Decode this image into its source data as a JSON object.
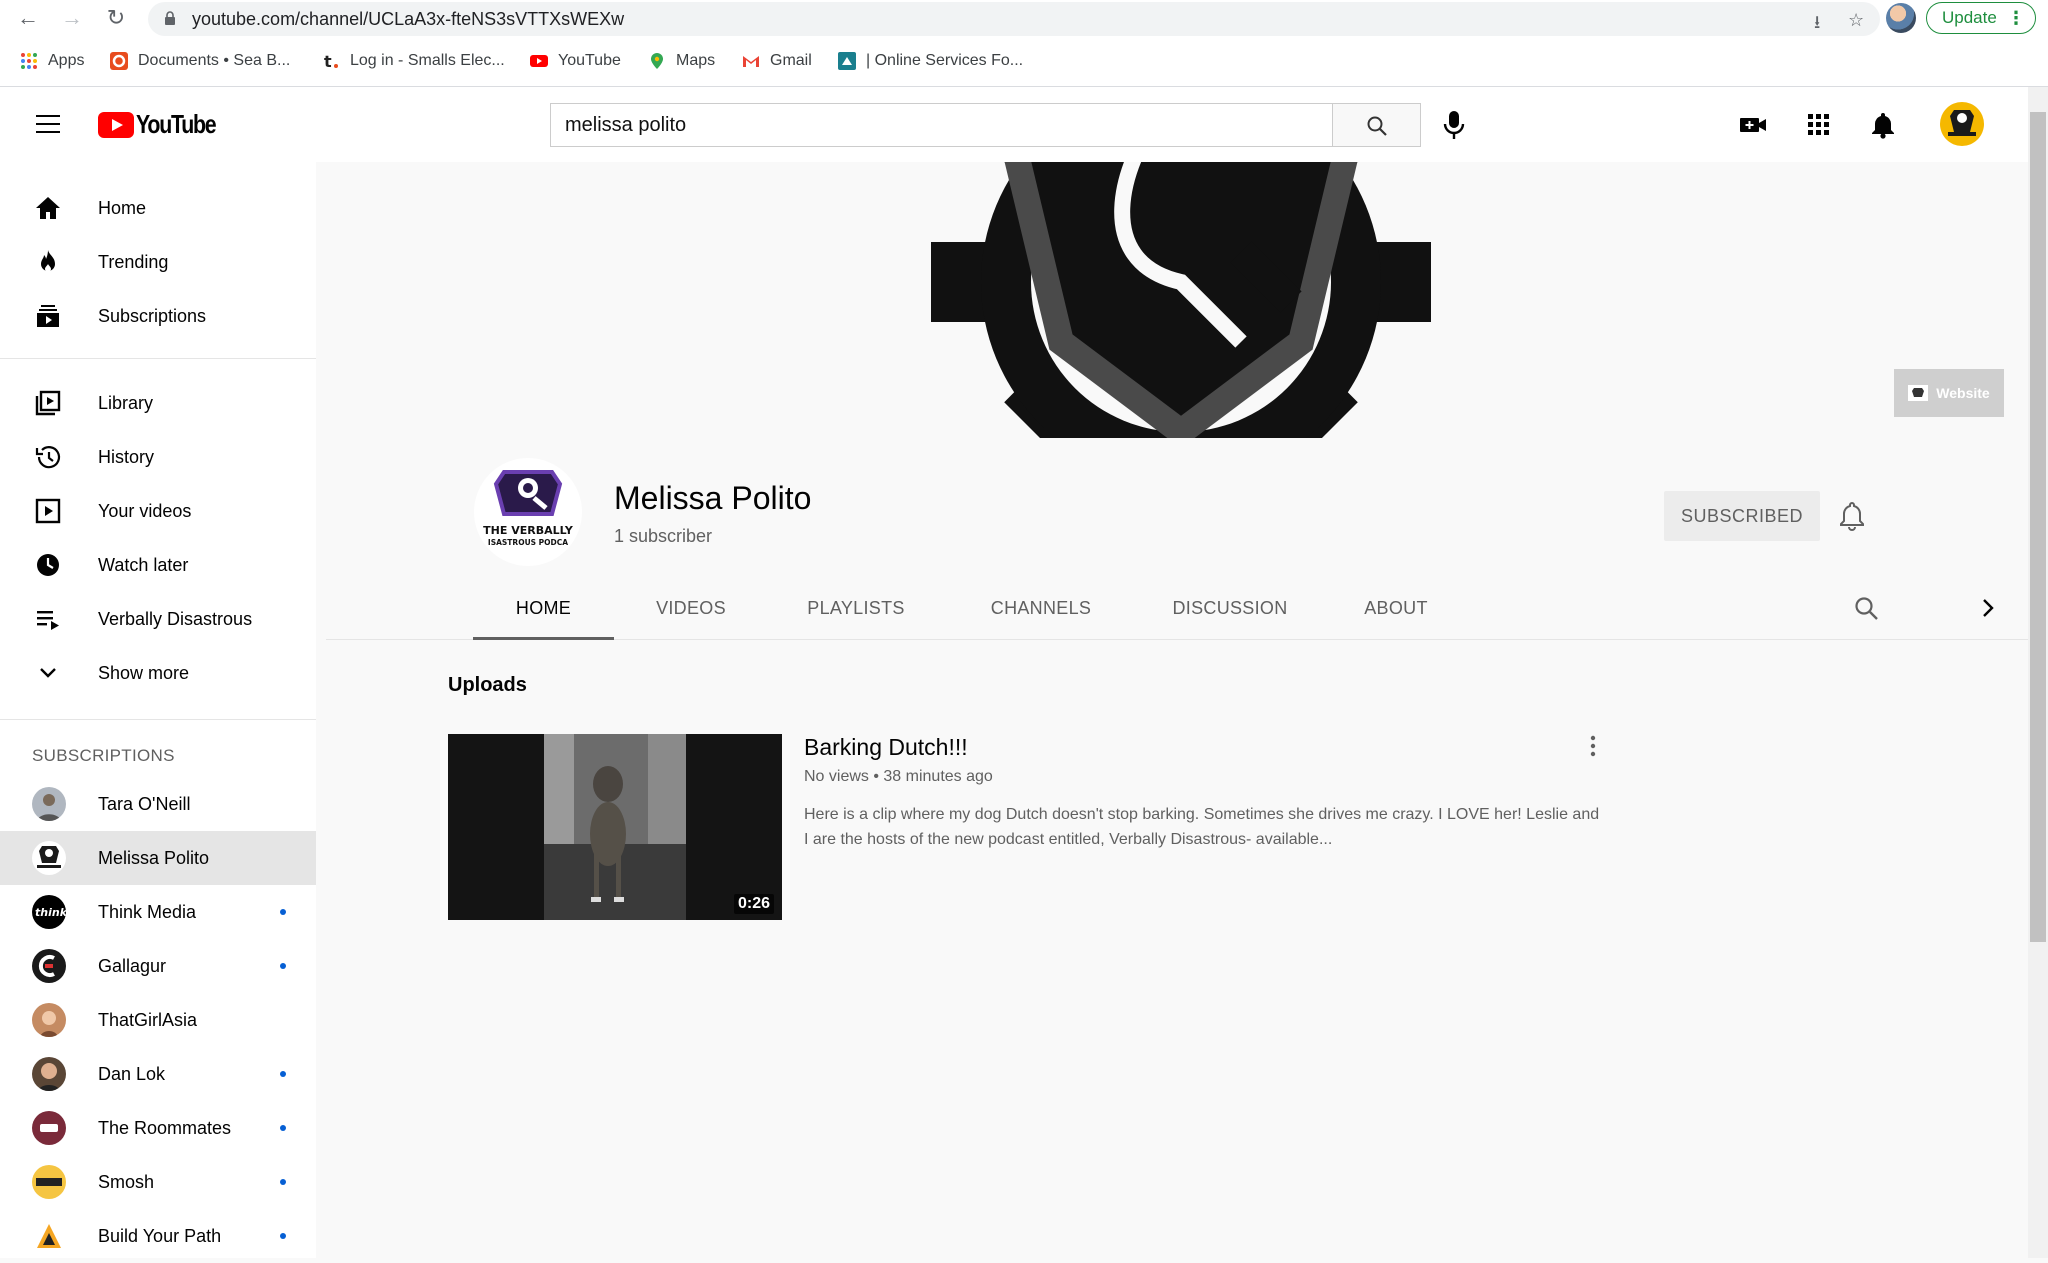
{
  "browser": {
    "url": "youtube.com/channel/UCLaA3x-fteNS3sVTTXsWEXw",
    "update_label": "Update",
    "bookmarks": [
      {
        "label": "Apps"
      },
      {
        "label": "Documents • Sea B..."
      },
      {
        "label": "Log in - Smalls Elec..."
      },
      {
        "label": "YouTube"
      },
      {
        "label": "Maps"
      },
      {
        "label": "Gmail"
      },
      {
        "label": "| Online Services Fo..."
      }
    ]
  },
  "header": {
    "logo_text": "YouTube",
    "search_value": "melissa polito"
  },
  "sidebar": {
    "main": [
      {
        "label": "Home",
        "icon": "home-icon"
      },
      {
        "label": "Trending",
        "icon": "trending-icon"
      },
      {
        "label": "Subscriptions",
        "icon": "subscriptions-icon"
      }
    ],
    "library": [
      {
        "label": "Library",
        "icon": "library-icon"
      },
      {
        "label": "History",
        "icon": "history-icon"
      },
      {
        "label": "Your videos",
        "icon": "your-videos-icon"
      },
      {
        "label": "Watch later",
        "icon": "watch-later-icon"
      },
      {
        "label": "Verbally Disastrous",
        "icon": "playlist-icon"
      },
      {
        "label": "Show more",
        "icon": "chevron-down-icon"
      }
    ],
    "subscriptions_heading": "SUBSCRIPTIONS",
    "subscriptions": [
      {
        "label": "Tara O'Neill",
        "new": false,
        "color": "#b0b7c0"
      },
      {
        "label": "Melissa Polito",
        "new": false,
        "color": "#ffffff",
        "active": true
      },
      {
        "label": "Think Media",
        "new": true,
        "color": "#000000"
      },
      {
        "label": "Gallagur",
        "new": true,
        "color": "#1a1a1a"
      },
      {
        "label": "ThatGirlAsia",
        "new": false,
        "color": "#c58b62"
      },
      {
        "label": "Dan Lok",
        "new": true,
        "color": "#5a4636"
      },
      {
        "label": "The Roommates",
        "new": true,
        "color": "#7a2a3a"
      },
      {
        "label": "Smosh",
        "new": true,
        "color": "#f5c542"
      },
      {
        "label": "Build Your Path",
        "new": true,
        "color": "#f5a623"
      }
    ]
  },
  "banner": {
    "website_label": "Website"
  },
  "channel": {
    "name": "Melissa Polito",
    "subscribers": "1 subscriber",
    "subscribed_label": "SUBSCRIBED",
    "avatar_text": "THE VERBALLY",
    "avatar_text2": "ISASTROUS PODCA",
    "tabs": [
      {
        "label": "HOME",
        "active": true
      },
      {
        "label": "VIDEOS"
      },
      {
        "label": "PLAYLISTS"
      },
      {
        "label": "CHANNELS"
      },
      {
        "label": "DISCUSSION"
      },
      {
        "label": "ABOUT"
      }
    ]
  },
  "content": {
    "section_title": "Uploads",
    "video": {
      "title": "Barking Dutch!!!",
      "meta": "No views • 38 minutes ago",
      "description": "Here is a clip where my dog Dutch doesn't stop barking. Sometimes she drives me crazy. I LOVE her! Leslie and I are the hosts of the new podcast entitled, Verbally Disastrous- available...",
      "duration": "0:26"
    }
  },
  "colors": {
    "accent_red": "#ff0000",
    "new_dot": "#065fd4",
    "update_green": "#1e8e3e"
  }
}
